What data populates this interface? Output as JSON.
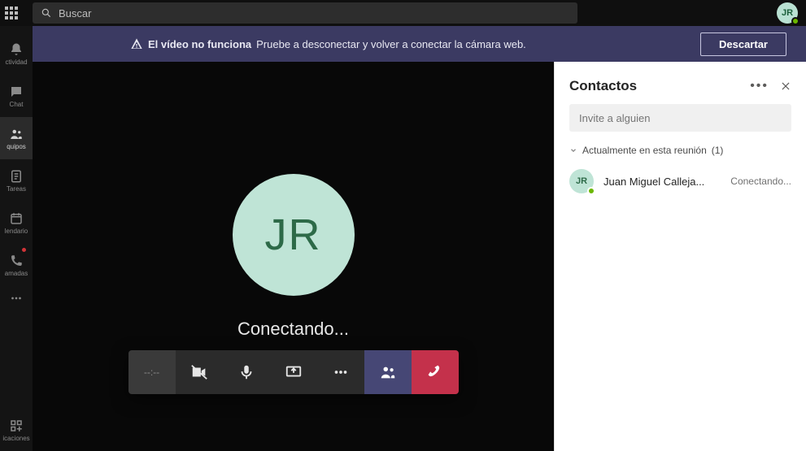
{
  "topbar": {
    "search_placeholder": "Buscar",
    "avatar_initials": "JR"
  },
  "rail": {
    "activity": "ctividad",
    "chat": "Chat",
    "teams": "quipos",
    "tasks": "Tareas",
    "calendar": "lendario",
    "calls": "amadas",
    "apps": "icaciones"
  },
  "banner": {
    "title": "El vídeo no funciona",
    "message": "Pruebe a desconectar y volver a conectar la cámara web.",
    "dismiss": "Descartar"
  },
  "stage": {
    "avatar_initials": "JR",
    "status": "Conectando...",
    "time": "--:--"
  },
  "contacts": {
    "title": "Contactos",
    "invite_placeholder": "Invite a alguien",
    "group_label": "Actualmente en esta reunión",
    "group_count": "(1)",
    "participants": [
      {
        "initials": "JR",
        "name": "Juan Miguel Calleja...",
        "status": "Conectando..."
      }
    ]
  }
}
